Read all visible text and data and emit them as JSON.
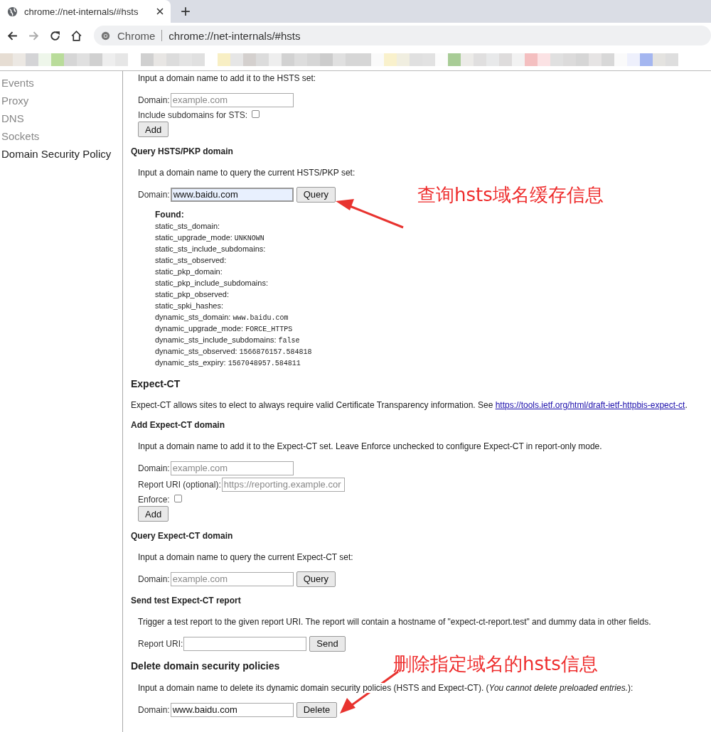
{
  "browser": {
    "tab_title": "chrome://net-internals/#hsts",
    "new_tab": "+",
    "site_label": "Chrome",
    "url": "chrome://net-internals/#hsts"
  },
  "sidebar": {
    "items": [
      {
        "label": "Events",
        "selected": false
      },
      {
        "label": "Proxy",
        "selected": false
      },
      {
        "label": "DNS",
        "selected": false
      },
      {
        "label": "Sockets",
        "selected": false
      },
      {
        "label": "Domain Security Policy",
        "selected": true
      }
    ]
  },
  "content": [
    {
      "kind": "note",
      "text": "Input a domain name to add it to the HSTS set:"
    },
    {
      "kind": "field",
      "label": "Domain:",
      "placeholder": "example.com"
    },
    {
      "kind": "checkbox",
      "label": "Include subdomains for STS:",
      "checked": false
    },
    {
      "kind": "button",
      "label": "Add"
    },
    {
      "kind": "subheading",
      "text": "Query HSTS/PKP domain"
    },
    {
      "kind": "note",
      "text": "Input a domain name to query the current HSTS/PKP set:"
    },
    {
      "kind": "field",
      "label": "Domain:",
      "value": "www.baidu.com",
      "button": "Query",
      "focused": true
    },
    {
      "kind": "results",
      "title": "Found:",
      "lines": [
        {
          "key": "static_sts_domain:"
        },
        {
          "key": "static_upgrade_mode:",
          "value": "UNKNOWN"
        },
        {
          "key": "static_sts_include_subdomains:"
        },
        {
          "key": "static_sts_observed:"
        },
        {
          "key": "static_pkp_domain:"
        },
        {
          "key": "static_pkp_include_subdomains:"
        },
        {
          "key": "static_pkp_observed:"
        },
        {
          "key": "static_spki_hashes:"
        },
        {
          "key": "dynamic_sts_domain:",
          "value": "www.baidu.com"
        },
        {
          "key": "dynamic_upgrade_mode:",
          "value": "FORCE_HTTPS"
        },
        {
          "key": "dynamic_sts_include_subdomains:",
          "value": "false"
        },
        {
          "key": "dynamic_sts_observed:",
          "value": "1566876157.584818"
        },
        {
          "key": "dynamic_sts_expiry:",
          "value": "1567048957.584811"
        }
      ]
    },
    {
      "kind": "heading",
      "text": "Expect-CT"
    },
    {
      "kind": "paragraph",
      "text": "Expect-CT allows sites to elect to always require valid Certificate Transparency information. See",
      "link": "https://tools.ietf.org/html/draft-ietf-httpbis-expect-ct",
      "after": "."
    },
    {
      "kind": "subheading",
      "text": "Add Expect-CT domain"
    },
    {
      "kind": "note",
      "text": "Input a domain name to add it to the Expect-CT set. Leave Enforce unchecked to configure Expect-CT in report-only mode."
    },
    {
      "kind": "field",
      "label": "Domain:",
      "placeholder": "example.com"
    },
    {
      "kind": "field",
      "label": "Report URI (optional):",
      "placeholder": "https://reporting.example.cor"
    },
    {
      "kind": "checkbox",
      "label": "Enforce:",
      "checked": false
    },
    {
      "kind": "button",
      "label": "Add"
    },
    {
      "kind": "subheading",
      "text": "Query Expect-CT domain"
    },
    {
      "kind": "note",
      "text": "Input a domain name to query the current Expect-CT set:"
    },
    {
      "kind": "field",
      "label": "Domain:",
      "placeholder": "example.com",
      "button": "Query"
    },
    {
      "kind": "subheading",
      "text": "Send test Expect-CT report"
    },
    {
      "kind": "note",
      "text": "Trigger a test report to the given report URI. The report will contain a hostname of \"expect-ct-report.test\" and dummy data in other fields."
    },
    {
      "kind": "field",
      "label": "Report URI:",
      "button": "Send"
    },
    {
      "kind": "subheading",
      "text": "Delete domain security policies"
    },
    {
      "kind": "note",
      "text": "Input a domain name to delete its dynamic domain security policies (HSTS and Expect-CT). (*You cannot delete preloaded entries.*):"
    },
    {
      "kind": "field",
      "label": "Domain:",
      "value": "www.baidu.com",
      "button": "Delete"
    }
  ],
  "annotations": [
    {
      "text": "查询hsts域名缓存信息"
    },
    {
      "text": "删除指定域名的hsts信息"
    }
  ]
}
